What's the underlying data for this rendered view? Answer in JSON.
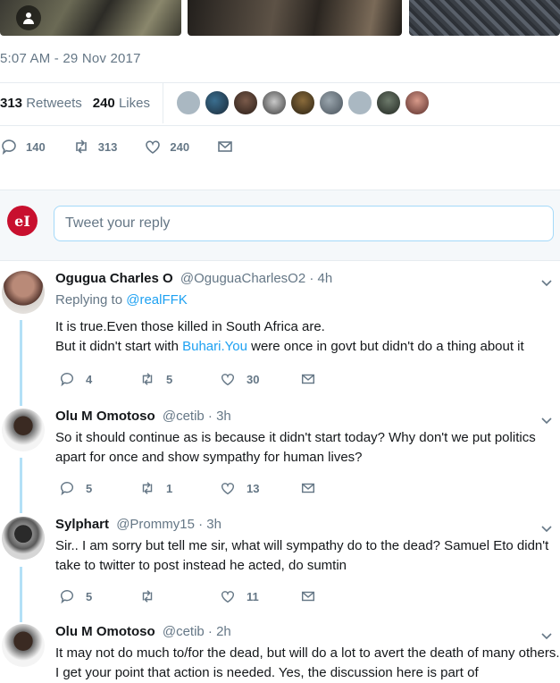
{
  "tweet": {
    "timestamp": "5:07 AM - 29 Nov 2017",
    "retweets_count": "313",
    "retweets_label": "Retweets",
    "likes_count": "240",
    "likes_label": "Likes",
    "actions": {
      "replies": "140",
      "retweets": "313",
      "likes": "240"
    }
  },
  "reply_box": {
    "placeholder": "Tweet your reply",
    "avatar_text": "eI"
  },
  "replies": [
    {
      "name": "Ogugua Charles O",
      "handle": "@OguguaCharlesO2 · 4h",
      "replying_to_label": "Replying to",
      "replying_to_handle": "@realFFK",
      "line1": "It is true.Even those killed in South Africa are.",
      "line2_pre": "But it didn't start with ",
      "line2_link": "Buhari.You",
      "line2_post": " were once in govt but didn't do a thing about it",
      "reply_count": "4",
      "retweet_count": "5",
      "like_count": "30"
    },
    {
      "name": "Olu M Omotoso",
      "handle": "@cetib · 3h",
      "text": "So it should continue as is because it didn't start today? Why don't we put politics apart for once and show sympathy for human lives?",
      "reply_count": "5",
      "retweet_count": "1",
      "like_count": "13"
    },
    {
      "name": "Sylphart",
      "handle": "@Prommy15 · 3h",
      "text": "Sir.. I am sorry but tell me sir, what will sympathy do to the dead? Samuel Eto didn't take to twitter to post instead he acted, do sumtin",
      "reply_count": "5",
      "retweet_count": "",
      "like_count": "11"
    },
    {
      "name": "Olu M Omotoso",
      "handle": "@cetib · 2h",
      "text": "It may not do much to/for the dead, but will do a lot to avert the death of many others. I get your point that action is needed. Yes, the discussion here is part of",
      "reply_count": "",
      "retweet_count": "",
      "like_count": ""
    }
  ],
  "colors": {
    "accent": "#1da1f2",
    "muted": "#657786",
    "text": "#14171a",
    "thread_line": "#b3e0f7"
  }
}
